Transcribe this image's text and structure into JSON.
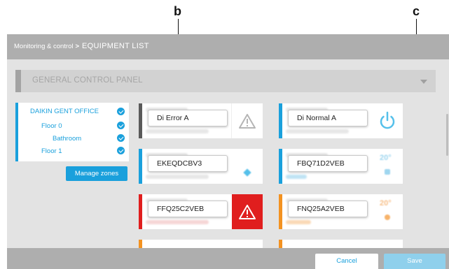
{
  "callouts": {
    "b": "b",
    "c": "c"
  },
  "breadcrumb": {
    "parent": "Monitoring & control",
    "separator": ">",
    "current": "EQUIPMENT LIST"
  },
  "panel": {
    "title": "GENERAL CONTROL PANEL"
  },
  "zones": [
    {
      "label": "DAIKIN GENT OFFICE",
      "checked": true
    },
    {
      "label": "Floor 0",
      "checked": true
    },
    {
      "label": "Bathroom",
      "checked": true
    },
    {
      "label": "Floor 1",
      "checked": true
    }
  ],
  "manage_zones_label": "Manage zones",
  "equipment": [
    {
      "name": "Di Error A",
      "stripe": "#5a5a5a",
      "icon": "warning-icon"
    },
    {
      "name": "Di Normal A",
      "stripe": "#1aa0dc",
      "icon": "power-icon"
    },
    {
      "name": "EKEQDCBV3",
      "stripe": "#1aa0dc",
      "icon": "fan-icon"
    },
    {
      "name": "FBQ71D2VEB",
      "stripe": "#1aa0dc",
      "icon": "temperature-icon",
      "temp": "20°"
    },
    {
      "name": "FFQ25C2VEB",
      "stripe": "#e01e1e",
      "icon": "warning-icon"
    },
    {
      "name": "FNQ25A2VEB",
      "stripe": "#f39221",
      "icon": "temperature-icon",
      "temp": "20°"
    }
  ],
  "footer": {
    "cancel_label": "Cancel",
    "save_label": "Save"
  },
  "colors": {
    "accent": "#1aa0dc",
    "error": "#e01e1e",
    "warning": "#f39221",
    "topbar": "#aeaeae",
    "content_bg": "#e3e3e3"
  }
}
